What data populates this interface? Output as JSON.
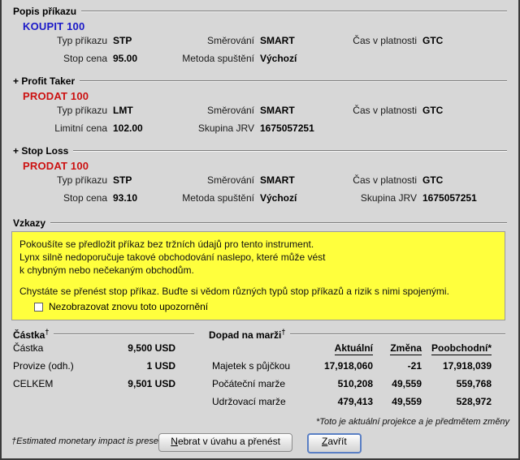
{
  "window": {
    "accent_buy": "#1a18c8",
    "accent_sell": "#cc1111",
    "warning_bg": "#ffff3d",
    "panel_bg": "#d7d7d7"
  },
  "order_description": {
    "group_title": "Popis příkazu",
    "side": "KOUPIT 100",
    "rows": [
      [
        {
          "label": "Typ příkazu",
          "value": "STP"
        },
        {
          "label": "Směrování",
          "value": "SMART"
        },
        {
          "label": "Čas v platnosti",
          "value": "GTC"
        }
      ],
      [
        {
          "label": "Stop cena",
          "value": "95.00"
        },
        {
          "label": "Metoda spuštění",
          "value": "Výchozí"
        },
        {
          "label": "",
          "value": ""
        }
      ]
    ]
  },
  "profit_taker": {
    "group_title": "+ Profit Taker",
    "side": "PRODAT 100",
    "rows": [
      [
        {
          "label": "Typ příkazu",
          "value": "LMT"
        },
        {
          "label": "Směrování",
          "value": "SMART"
        },
        {
          "label": "Čas v platnosti",
          "value": "GTC"
        }
      ],
      [
        {
          "label": "Limitní cena",
          "value": "102.00"
        },
        {
          "label": "Skupina JRV",
          "value": "1675057251"
        },
        {
          "label": "",
          "value": ""
        }
      ]
    ]
  },
  "stop_loss": {
    "group_title": "+ Stop Loss",
    "side": "PRODAT 100",
    "rows": [
      [
        {
          "label": "Typ příkazu",
          "value": "STP"
        },
        {
          "label": "Směrování",
          "value": "SMART"
        },
        {
          "label": "Čas v platnosti",
          "value": "GTC"
        }
      ],
      [
        {
          "label": "Stop cena",
          "value": "93.10"
        },
        {
          "label": "Metoda spuštění",
          "value": "Výchozí"
        },
        {
          "label": "Skupina JRV",
          "value": "1675057251"
        }
      ]
    ]
  },
  "messages": {
    "group_title": "Vzkazy",
    "line1": "Pokoušíte se předložit příkaz bez tržních údajů pro tento instrument.",
    "line2": "Lynx silně nedoporučuje takové obchodování naslepo, které může vést",
    "line3": "k chybným nebo nečekaným obchodům.",
    "line4": "Chystáte se přenést stop příkaz. Buďte si vědom různých typů stop příkazů a rizik s nimi spojenými.",
    "checkbox_label": "Nezobrazovat znovu toto upozornění",
    "checkbox_checked": false
  },
  "amount": {
    "group_title": "Částka",
    "group_title_sup": "†",
    "rows": [
      {
        "label": "Částka",
        "value": "9,500 USD"
      },
      {
        "label": "Provize (odh.)",
        "value": "1 USD"
      },
      {
        "label": "CELKEM",
        "value": "9,501 USD"
      }
    ]
  },
  "margin_impact": {
    "group_title": "Dopad na marži",
    "group_title_sup": "†",
    "headers": [
      "Aktuální",
      "Změna",
      "Poobchodní*"
    ],
    "rows": [
      {
        "label": "Majetek s půjčkou",
        "current": "17,918,060",
        "change": "-21",
        "post": "17,918,039"
      },
      {
        "label": "Počáteční marže",
        "current": "510,208",
        "change": "49,559",
        "post": "559,768"
      },
      {
        "label": "Udržovací marže",
        "current": "479,413",
        "change": "49,559",
        "post": "528,972"
      }
    ],
    "note": "*Toto je aktuální projekce a je předmětem změny"
  },
  "footnote": "†Estimated monetary impact is presented for main order only",
  "buttons": {
    "transmit_label_prefix": "N",
    "transmit_label_rest": "ebrat v úvahu a přenést",
    "close_label_prefix": "Z",
    "close_label_rest": "avřít"
  }
}
